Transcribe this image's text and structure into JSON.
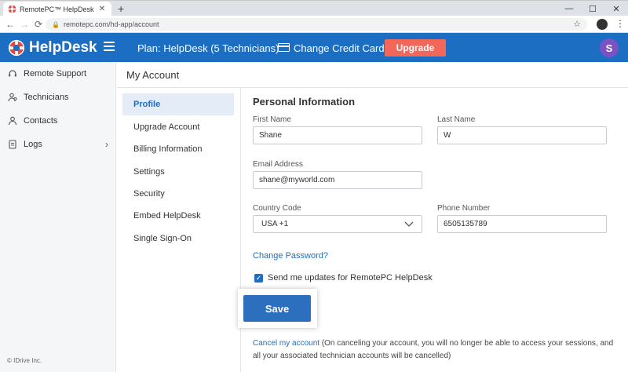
{
  "browser": {
    "tab_title": "RemotePC™ HelpDesk - my accoun",
    "tab_close": "✕",
    "new_tab": "+",
    "url": "remotepc.com/hd-app/account",
    "win_minimize": "—",
    "win_maximize": "☐",
    "win_close": "✕"
  },
  "header": {
    "logo_text": "HelpDesk",
    "plan": "Plan: HelpDesk (5 Technicians)",
    "change_card": "Change Credit Card",
    "upgrade": "Upgrade",
    "avatar_initial": "S",
    "colors": {
      "header_bg": "#1b6ec2",
      "upgrade_bg": "#f2675a",
      "avatar_bg": "#7b52c4"
    }
  },
  "sidebar": {
    "items": [
      {
        "label": "Remote Support",
        "icon": "headset-icon"
      },
      {
        "label": "Technicians",
        "icon": "technicians-icon"
      },
      {
        "label": "Contacts",
        "icon": "contact-icon"
      },
      {
        "label": "Logs",
        "icon": "logs-icon"
      }
    ],
    "copyright": "© IDrive Inc."
  },
  "account": {
    "title": "My Account",
    "nav": [
      {
        "label": "Profile",
        "active": true
      },
      {
        "label": "Upgrade Account"
      },
      {
        "label": "Billing Information"
      },
      {
        "label": "Settings"
      },
      {
        "label": "Security"
      },
      {
        "label": "Embed HelpDesk"
      },
      {
        "label": "Single Sign-On"
      }
    ]
  },
  "form": {
    "section_title": "Personal Information",
    "first_name_label": "First Name",
    "first_name": "Shane",
    "last_name_label": "Last Name",
    "last_name": "W",
    "email_label": "Email Address",
    "email": "shane@myworld.com",
    "country_code_label": "Country Code",
    "country_code": "USA +1",
    "phone_label": "Phone Number",
    "phone": "6505135789",
    "change_password": "Change Password?",
    "updates_checkbox": "Send me updates for RemotePC HelpDesk",
    "save": "Save",
    "cancel_link": "Cancel my account",
    "cancel_note": " (On canceling your account, you will no longer be able to access your sessions, and all your associated technician accounts will be cancelled)"
  }
}
